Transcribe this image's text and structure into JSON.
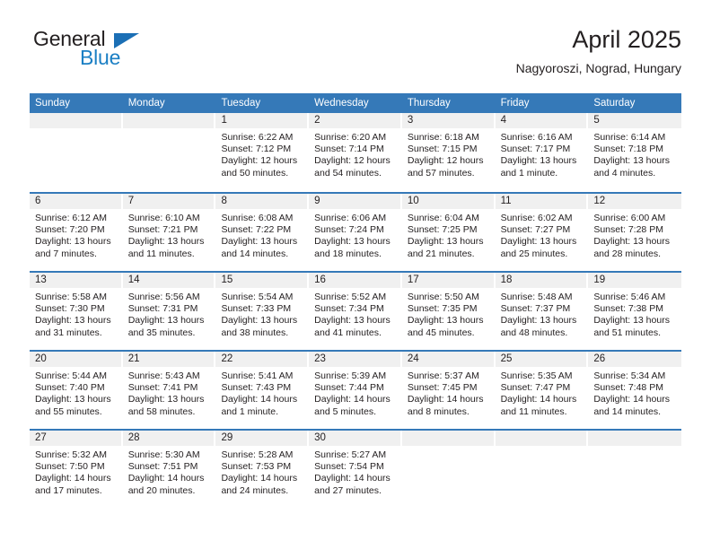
{
  "brand": {
    "name_part1": "General",
    "name_part2": "Blue",
    "triangle_color": "#1b6fb5",
    "accent_color": "#1b7fc4"
  },
  "header": {
    "title": "April 2025",
    "subtitle": "Nagyoroszi, Nograd, Hungary"
  },
  "theme": {
    "header_blue": "#3579b8",
    "daynum_band": "#f0f0f0",
    "text": "#231f20"
  },
  "weekdays": [
    "Sunday",
    "Monday",
    "Tuesday",
    "Wednesday",
    "Thursday",
    "Friday",
    "Saturday"
  ],
  "weeks": [
    [
      {
        "day": ""
      },
      {
        "day": ""
      },
      {
        "day": "1",
        "sunrise": "Sunrise: 6:22 AM",
        "sunset": "Sunset: 7:12 PM",
        "daylight1": "Daylight: 12 hours",
        "daylight2": "and 50 minutes."
      },
      {
        "day": "2",
        "sunrise": "Sunrise: 6:20 AM",
        "sunset": "Sunset: 7:14 PM",
        "daylight1": "Daylight: 12 hours",
        "daylight2": "and 54 minutes."
      },
      {
        "day": "3",
        "sunrise": "Sunrise: 6:18 AM",
        "sunset": "Sunset: 7:15 PM",
        "daylight1": "Daylight: 12 hours",
        "daylight2": "and 57 minutes."
      },
      {
        "day": "4",
        "sunrise": "Sunrise: 6:16 AM",
        "sunset": "Sunset: 7:17 PM",
        "daylight1": "Daylight: 13 hours",
        "daylight2": "and 1 minute."
      },
      {
        "day": "5",
        "sunrise": "Sunrise: 6:14 AM",
        "sunset": "Sunset: 7:18 PM",
        "daylight1": "Daylight: 13 hours",
        "daylight2": "and 4 minutes."
      }
    ],
    [
      {
        "day": "6",
        "sunrise": "Sunrise: 6:12 AM",
        "sunset": "Sunset: 7:20 PM",
        "daylight1": "Daylight: 13 hours",
        "daylight2": "and 7 minutes."
      },
      {
        "day": "7",
        "sunrise": "Sunrise: 6:10 AM",
        "sunset": "Sunset: 7:21 PM",
        "daylight1": "Daylight: 13 hours",
        "daylight2": "and 11 minutes."
      },
      {
        "day": "8",
        "sunrise": "Sunrise: 6:08 AM",
        "sunset": "Sunset: 7:22 PM",
        "daylight1": "Daylight: 13 hours",
        "daylight2": "and 14 minutes."
      },
      {
        "day": "9",
        "sunrise": "Sunrise: 6:06 AM",
        "sunset": "Sunset: 7:24 PM",
        "daylight1": "Daylight: 13 hours",
        "daylight2": "and 18 minutes."
      },
      {
        "day": "10",
        "sunrise": "Sunrise: 6:04 AM",
        "sunset": "Sunset: 7:25 PM",
        "daylight1": "Daylight: 13 hours",
        "daylight2": "and 21 minutes."
      },
      {
        "day": "11",
        "sunrise": "Sunrise: 6:02 AM",
        "sunset": "Sunset: 7:27 PM",
        "daylight1": "Daylight: 13 hours",
        "daylight2": "and 25 minutes."
      },
      {
        "day": "12",
        "sunrise": "Sunrise: 6:00 AM",
        "sunset": "Sunset: 7:28 PM",
        "daylight1": "Daylight: 13 hours",
        "daylight2": "and 28 minutes."
      }
    ],
    [
      {
        "day": "13",
        "sunrise": "Sunrise: 5:58 AM",
        "sunset": "Sunset: 7:30 PM",
        "daylight1": "Daylight: 13 hours",
        "daylight2": "and 31 minutes."
      },
      {
        "day": "14",
        "sunrise": "Sunrise: 5:56 AM",
        "sunset": "Sunset: 7:31 PM",
        "daylight1": "Daylight: 13 hours",
        "daylight2": "and 35 minutes."
      },
      {
        "day": "15",
        "sunrise": "Sunrise: 5:54 AM",
        "sunset": "Sunset: 7:33 PM",
        "daylight1": "Daylight: 13 hours",
        "daylight2": "and 38 minutes."
      },
      {
        "day": "16",
        "sunrise": "Sunrise: 5:52 AM",
        "sunset": "Sunset: 7:34 PM",
        "daylight1": "Daylight: 13 hours",
        "daylight2": "and 41 minutes."
      },
      {
        "day": "17",
        "sunrise": "Sunrise: 5:50 AM",
        "sunset": "Sunset: 7:35 PM",
        "daylight1": "Daylight: 13 hours",
        "daylight2": "and 45 minutes."
      },
      {
        "day": "18",
        "sunrise": "Sunrise: 5:48 AM",
        "sunset": "Sunset: 7:37 PM",
        "daylight1": "Daylight: 13 hours",
        "daylight2": "and 48 minutes."
      },
      {
        "day": "19",
        "sunrise": "Sunrise: 5:46 AM",
        "sunset": "Sunset: 7:38 PM",
        "daylight1": "Daylight: 13 hours",
        "daylight2": "and 51 minutes."
      }
    ],
    [
      {
        "day": "20",
        "sunrise": "Sunrise: 5:44 AM",
        "sunset": "Sunset: 7:40 PM",
        "daylight1": "Daylight: 13 hours",
        "daylight2": "and 55 minutes."
      },
      {
        "day": "21",
        "sunrise": "Sunrise: 5:43 AM",
        "sunset": "Sunset: 7:41 PM",
        "daylight1": "Daylight: 13 hours",
        "daylight2": "and 58 minutes."
      },
      {
        "day": "22",
        "sunrise": "Sunrise: 5:41 AM",
        "sunset": "Sunset: 7:43 PM",
        "daylight1": "Daylight: 14 hours",
        "daylight2": "and 1 minute."
      },
      {
        "day": "23",
        "sunrise": "Sunrise: 5:39 AM",
        "sunset": "Sunset: 7:44 PM",
        "daylight1": "Daylight: 14 hours",
        "daylight2": "and 5 minutes."
      },
      {
        "day": "24",
        "sunrise": "Sunrise: 5:37 AM",
        "sunset": "Sunset: 7:45 PM",
        "daylight1": "Daylight: 14 hours",
        "daylight2": "and 8 minutes."
      },
      {
        "day": "25",
        "sunrise": "Sunrise: 5:35 AM",
        "sunset": "Sunset: 7:47 PM",
        "daylight1": "Daylight: 14 hours",
        "daylight2": "and 11 minutes."
      },
      {
        "day": "26",
        "sunrise": "Sunrise: 5:34 AM",
        "sunset": "Sunset: 7:48 PM",
        "daylight1": "Daylight: 14 hours",
        "daylight2": "and 14 minutes."
      }
    ],
    [
      {
        "day": "27",
        "sunrise": "Sunrise: 5:32 AM",
        "sunset": "Sunset: 7:50 PM",
        "daylight1": "Daylight: 14 hours",
        "daylight2": "and 17 minutes."
      },
      {
        "day": "28",
        "sunrise": "Sunrise: 5:30 AM",
        "sunset": "Sunset: 7:51 PM",
        "daylight1": "Daylight: 14 hours",
        "daylight2": "and 20 minutes."
      },
      {
        "day": "29",
        "sunrise": "Sunrise: 5:28 AM",
        "sunset": "Sunset: 7:53 PM",
        "daylight1": "Daylight: 14 hours",
        "daylight2": "and 24 minutes."
      },
      {
        "day": "30",
        "sunrise": "Sunrise: 5:27 AM",
        "sunset": "Sunset: 7:54 PM",
        "daylight1": "Daylight: 14 hours",
        "daylight2": "and 27 minutes."
      },
      {
        "day": ""
      },
      {
        "day": ""
      },
      {
        "day": ""
      }
    ]
  ]
}
